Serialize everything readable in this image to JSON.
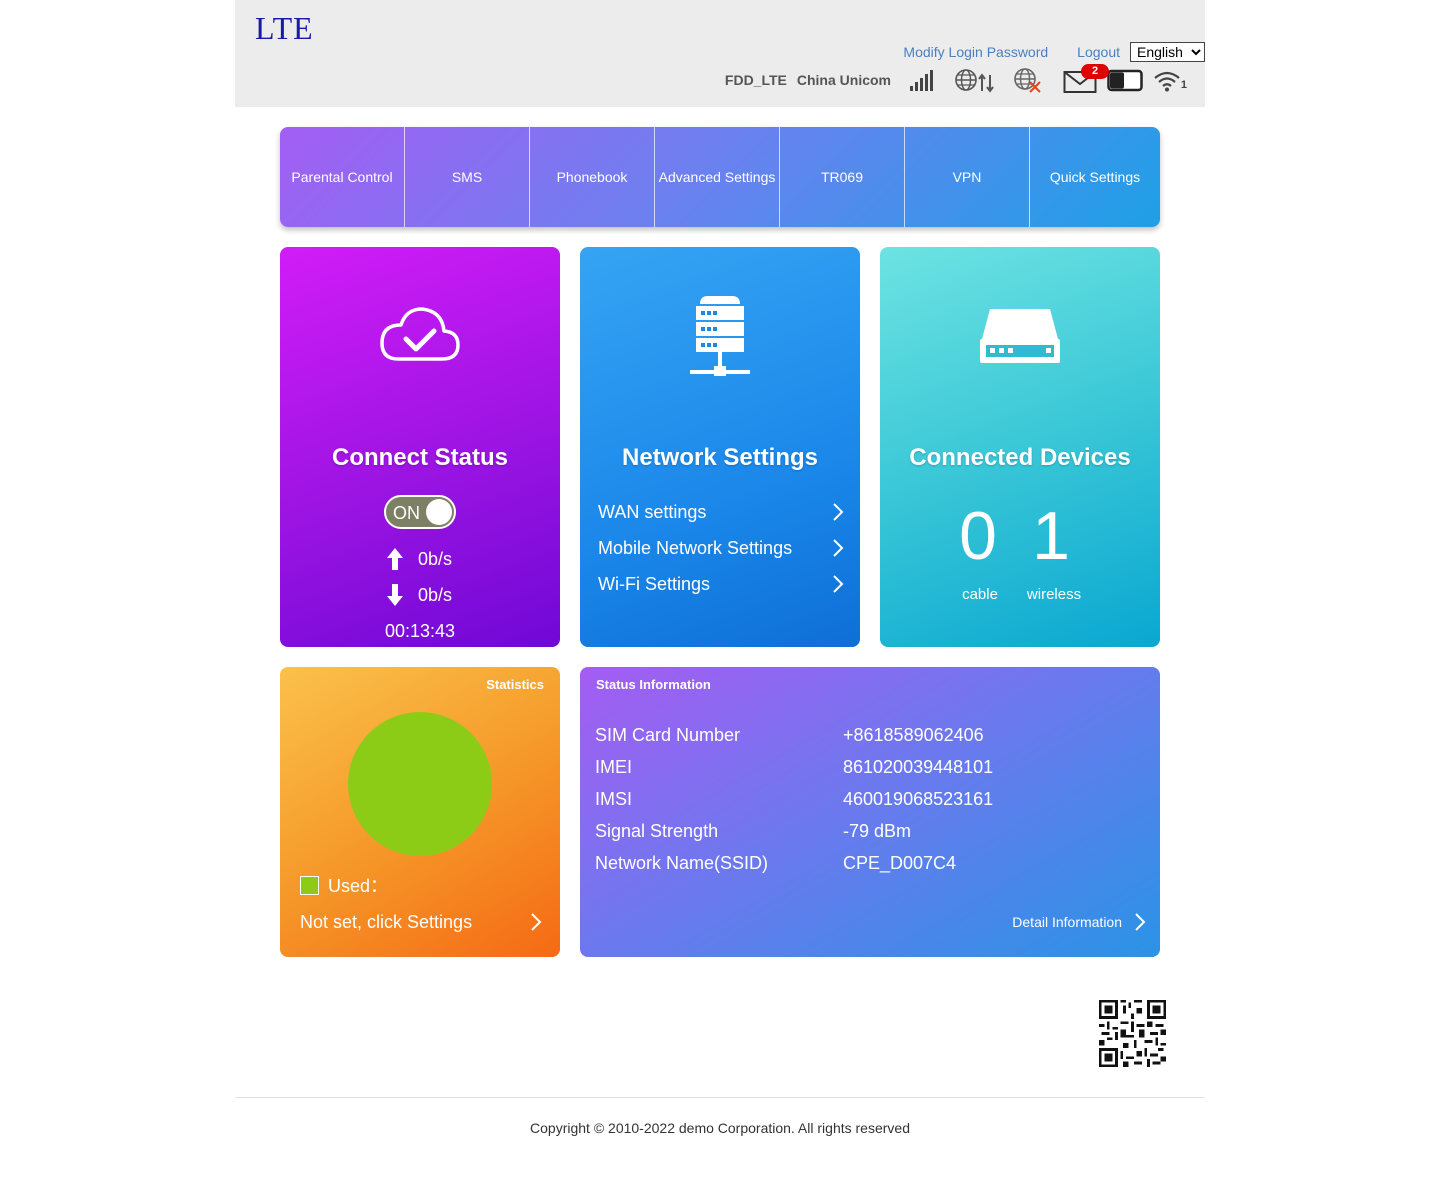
{
  "header": {
    "logo": "LTE",
    "modify_password": "Modify Login Password",
    "logout": "Logout",
    "language": "English",
    "network_type": "FDD_LTE",
    "carrier": "China Unicom",
    "unread_sms": "2",
    "wifi_clients": "1"
  },
  "nav": {
    "items": [
      "Parental Control",
      "SMS",
      "Phonebook",
      "Advanced Settings",
      "TR069",
      "VPN",
      "Quick Settings"
    ]
  },
  "connect": {
    "title": "Connect Status",
    "toggle": "ON",
    "upload_rate": "0b/s",
    "download_rate": "0b/s",
    "uptime": "00:13:43"
  },
  "network": {
    "title": "Network Settings",
    "links": [
      "WAN settings",
      "Mobile Network Settings",
      "Wi-Fi Settings"
    ]
  },
  "devices": {
    "title": "Connected Devices",
    "cable_count": "0",
    "wireless_count": "1",
    "cable_label": "cable",
    "wireless_label": "wireless"
  },
  "statistics": {
    "title": "Statistics",
    "used_label": "Used：",
    "settings_link": "Not set, click Settings",
    "used_color": "#8ccc16"
  },
  "status_info": {
    "title": "Status Information",
    "rows": [
      {
        "label": "SIM Card Number",
        "value": "+8618589062406"
      },
      {
        "label": "IMEI",
        "value": "861020039448101"
      },
      {
        "label": "IMSI",
        "value": "460019068523161"
      },
      {
        "label": "Signal Strength",
        "value": "-79 dBm"
      },
      {
        "label": "Network Name(SSID)",
        "value": "CPE_D007C4"
      }
    ],
    "detail_link": "Detail Information"
  },
  "footer": {
    "copyright": "Copyright © 2010-2022 demo Corporation. All rights reserved"
  }
}
